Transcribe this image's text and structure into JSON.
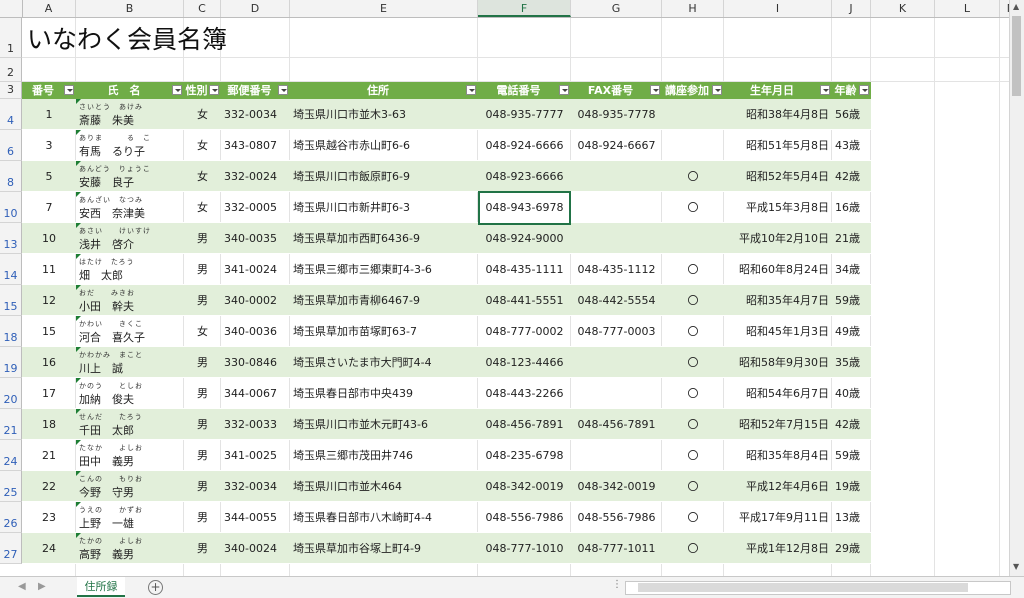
{
  "sheet": {
    "title": "いなわく会員名簿",
    "selected_column": "F",
    "columns": [
      "A",
      "B",
      "C",
      "D",
      "E",
      "F",
      "G",
      "H",
      "I",
      "J",
      "K",
      "L",
      "M"
    ],
    "row_numbers": [
      "1",
      "2",
      "3",
      "4",
      "6",
      "8",
      "10",
      "13",
      "14",
      "15",
      "18",
      "19",
      "20",
      "21",
      "24",
      "25",
      "26",
      "27"
    ]
  },
  "table": {
    "headers": [
      "番号",
      "氏　名",
      "性別",
      "郵便番号",
      "住所",
      "電話番号",
      "FAX番号",
      "講座参加",
      "生年月日",
      "年齢"
    ],
    "rows": [
      {
        "no": "1",
        "furi": "さいとう　あけみ",
        "name": "斎藤　朱美",
        "sex": "女",
        "zip": "332-0034",
        "addr": "埼玉県川口市並木3-63",
        "tel": "048-935-7777",
        "fax": "048-935-7778",
        "course": "",
        "birth": "昭和38年4月8日",
        "age": "56歳"
      },
      {
        "no": "3",
        "furi": "ありま　　　る　こ",
        "name": "有馬　るり子",
        "sex": "女",
        "zip": "343-0807",
        "addr": "埼玉県越谷市赤山町6-6",
        "tel": "048-924-6666",
        "fax": "048-924-6667",
        "course": "",
        "birth": "昭和51年5月8日",
        "age": "43歳"
      },
      {
        "no": "5",
        "furi": "あんどう　りょうこ",
        "name": "安藤　良子",
        "sex": "女",
        "zip": "332-0024",
        "addr": "埼玉県川口市飯原町6-9",
        "tel": "048-923-6666",
        "fax": "",
        "course": "〇",
        "birth": "昭和52年5月4日",
        "age": "42歳"
      },
      {
        "no": "7",
        "furi": "あんざい　なつみ",
        "name": "安西　奈津美",
        "sex": "女",
        "zip": "332-0005",
        "addr": "埼玉県川口市新井町6-3",
        "tel": "048-943-6978",
        "fax": "",
        "course": "〇",
        "birth": "平成15年3月8日",
        "age": "16歳"
      },
      {
        "no": "10",
        "furi": "あさい　　けいすけ",
        "name": "浅井　啓介",
        "sex": "男",
        "zip": "340-0035",
        "addr": "埼玉県草加市西町6436-9",
        "tel": "048-924-9000",
        "fax": "",
        "course": "",
        "birth": "平成10年2月10日",
        "age": "21歳"
      },
      {
        "no": "11",
        "furi": "はたけ　たろう",
        "name": "畑　太郎",
        "sex": "男",
        "zip": "341-0024",
        "addr": "埼玉県三郷市三郷東町4-3-6",
        "tel": "048-435-1111",
        "fax": "048-435-1112",
        "course": "〇",
        "birth": "昭和60年8月24日",
        "age": "34歳"
      },
      {
        "no": "12",
        "furi": "おだ　　みきお",
        "name": "小田　幹夫",
        "sex": "男",
        "zip": "340-0002",
        "addr": "埼玉県草加市青柳6467-9",
        "tel": "048-441-5551",
        "fax": "048-442-5554",
        "course": "〇",
        "birth": "昭和35年4月7日",
        "age": "59歳"
      },
      {
        "no": "15",
        "furi": "かわい　　きくこ",
        "name": "河合　喜久子",
        "sex": "女",
        "zip": "340-0036",
        "addr": "埼玉県草加市苗塚町63-7",
        "tel": "048-777-0002",
        "fax": "048-777-0003",
        "course": "〇",
        "birth": "昭和45年1月3日",
        "age": "49歳"
      },
      {
        "no": "16",
        "furi": "かわかみ　まこと",
        "name": "川上　誠",
        "sex": "男",
        "zip": "330-0846",
        "addr": "埼玉県さいたま市大門町4-4",
        "tel": "048-123-4466",
        "fax": "",
        "course": "〇",
        "birth": "昭和58年9月30日",
        "age": "35歳"
      },
      {
        "no": "17",
        "furi": "かのう　　としお",
        "name": "加納　俊夫",
        "sex": "男",
        "zip": "344-0067",
        "addr": "埼玉県春日部市中央439",
        "tel": "048-443-2266",
        "fax": "",
        "course": "〇",
        "birth": "昭和54年6月7日",
        "age": "40歳"
      },
      {
        "no": "18",
        "furi": "せんだ　　たろう",
        "name": "千田　太郎",
        "sex": "男",
        "zip": "332-0033",
        "addr": "埼玉県川口市並木元町43-6",
        "tel": "048-456-7891",
        "fax": "048-456-7891",
        "course": "〇",
        "birth": "昭和52年7月15日",
        "age": "42歳"
      },
      {
        "no": "21",
        "furi": "たなか　　よしお",
        "name": "田中　義男",
        "sex": "男",
        "zip": "341-0025",
        "addr": "埼玉県三郷市茂田井746",
        "tel": "048-235-6798",
        "fax": "",
        "course": "〇",
        "birth": "昭和35年8月4日",
        "age": "59歳"
      },
      {
        "no": "22",
        "furi": "こんの　　もりお",
        "name": "今野　守男",
        "sex": "男",
        "zip": "332-0034",
        "addr": "埼玉県川口市並木464",
        "tel": "048-342-0019",
        "fax": "048-342-0019",
        "course": "〇",
        "birth": "平成12年4月6日",
        "age": "19歳"
      },
      {
        "no": "23",
        "furi": "うえの　　かずお",
        "name": "上野　一雄",
        "sex": "男",
        "zip": "344-0055",
        "addr": "埼玉県春日部市八木崎町4-4",
        "tel": "048-556-7986",
        "fax": "048-556-7986",
        "course": "〇",
        "birth": "平成17年9月11日",
        "age": "13歳"
      },
      {
        "no": "24",
        "furi": "たかの　　よしお",
        "name": "高野　義男",
        "sex": "男",
        "zip": "340-0024",
        "addr": "埼玉県草加市谷塚上町4-9",
        "tel": "048-777-1010",
        "fax": "048-777-1011",
        "course": "〇",
        "birth": "平成1年12月8日",
        "age": "29歳"
      }
    ]
  },
  "tabs": {
    "active": "住所録"
  },
  "icons": {
    "add_sheet": "plus-circle-icon",
    "filter": "filter-icon",
    "dropdown": "chevron-down-icon"
  },
  "colors": {
    "header_green": "#70ad47",
    "band": "#e2efda",
    "excel_green": "#217346"
  }
}
